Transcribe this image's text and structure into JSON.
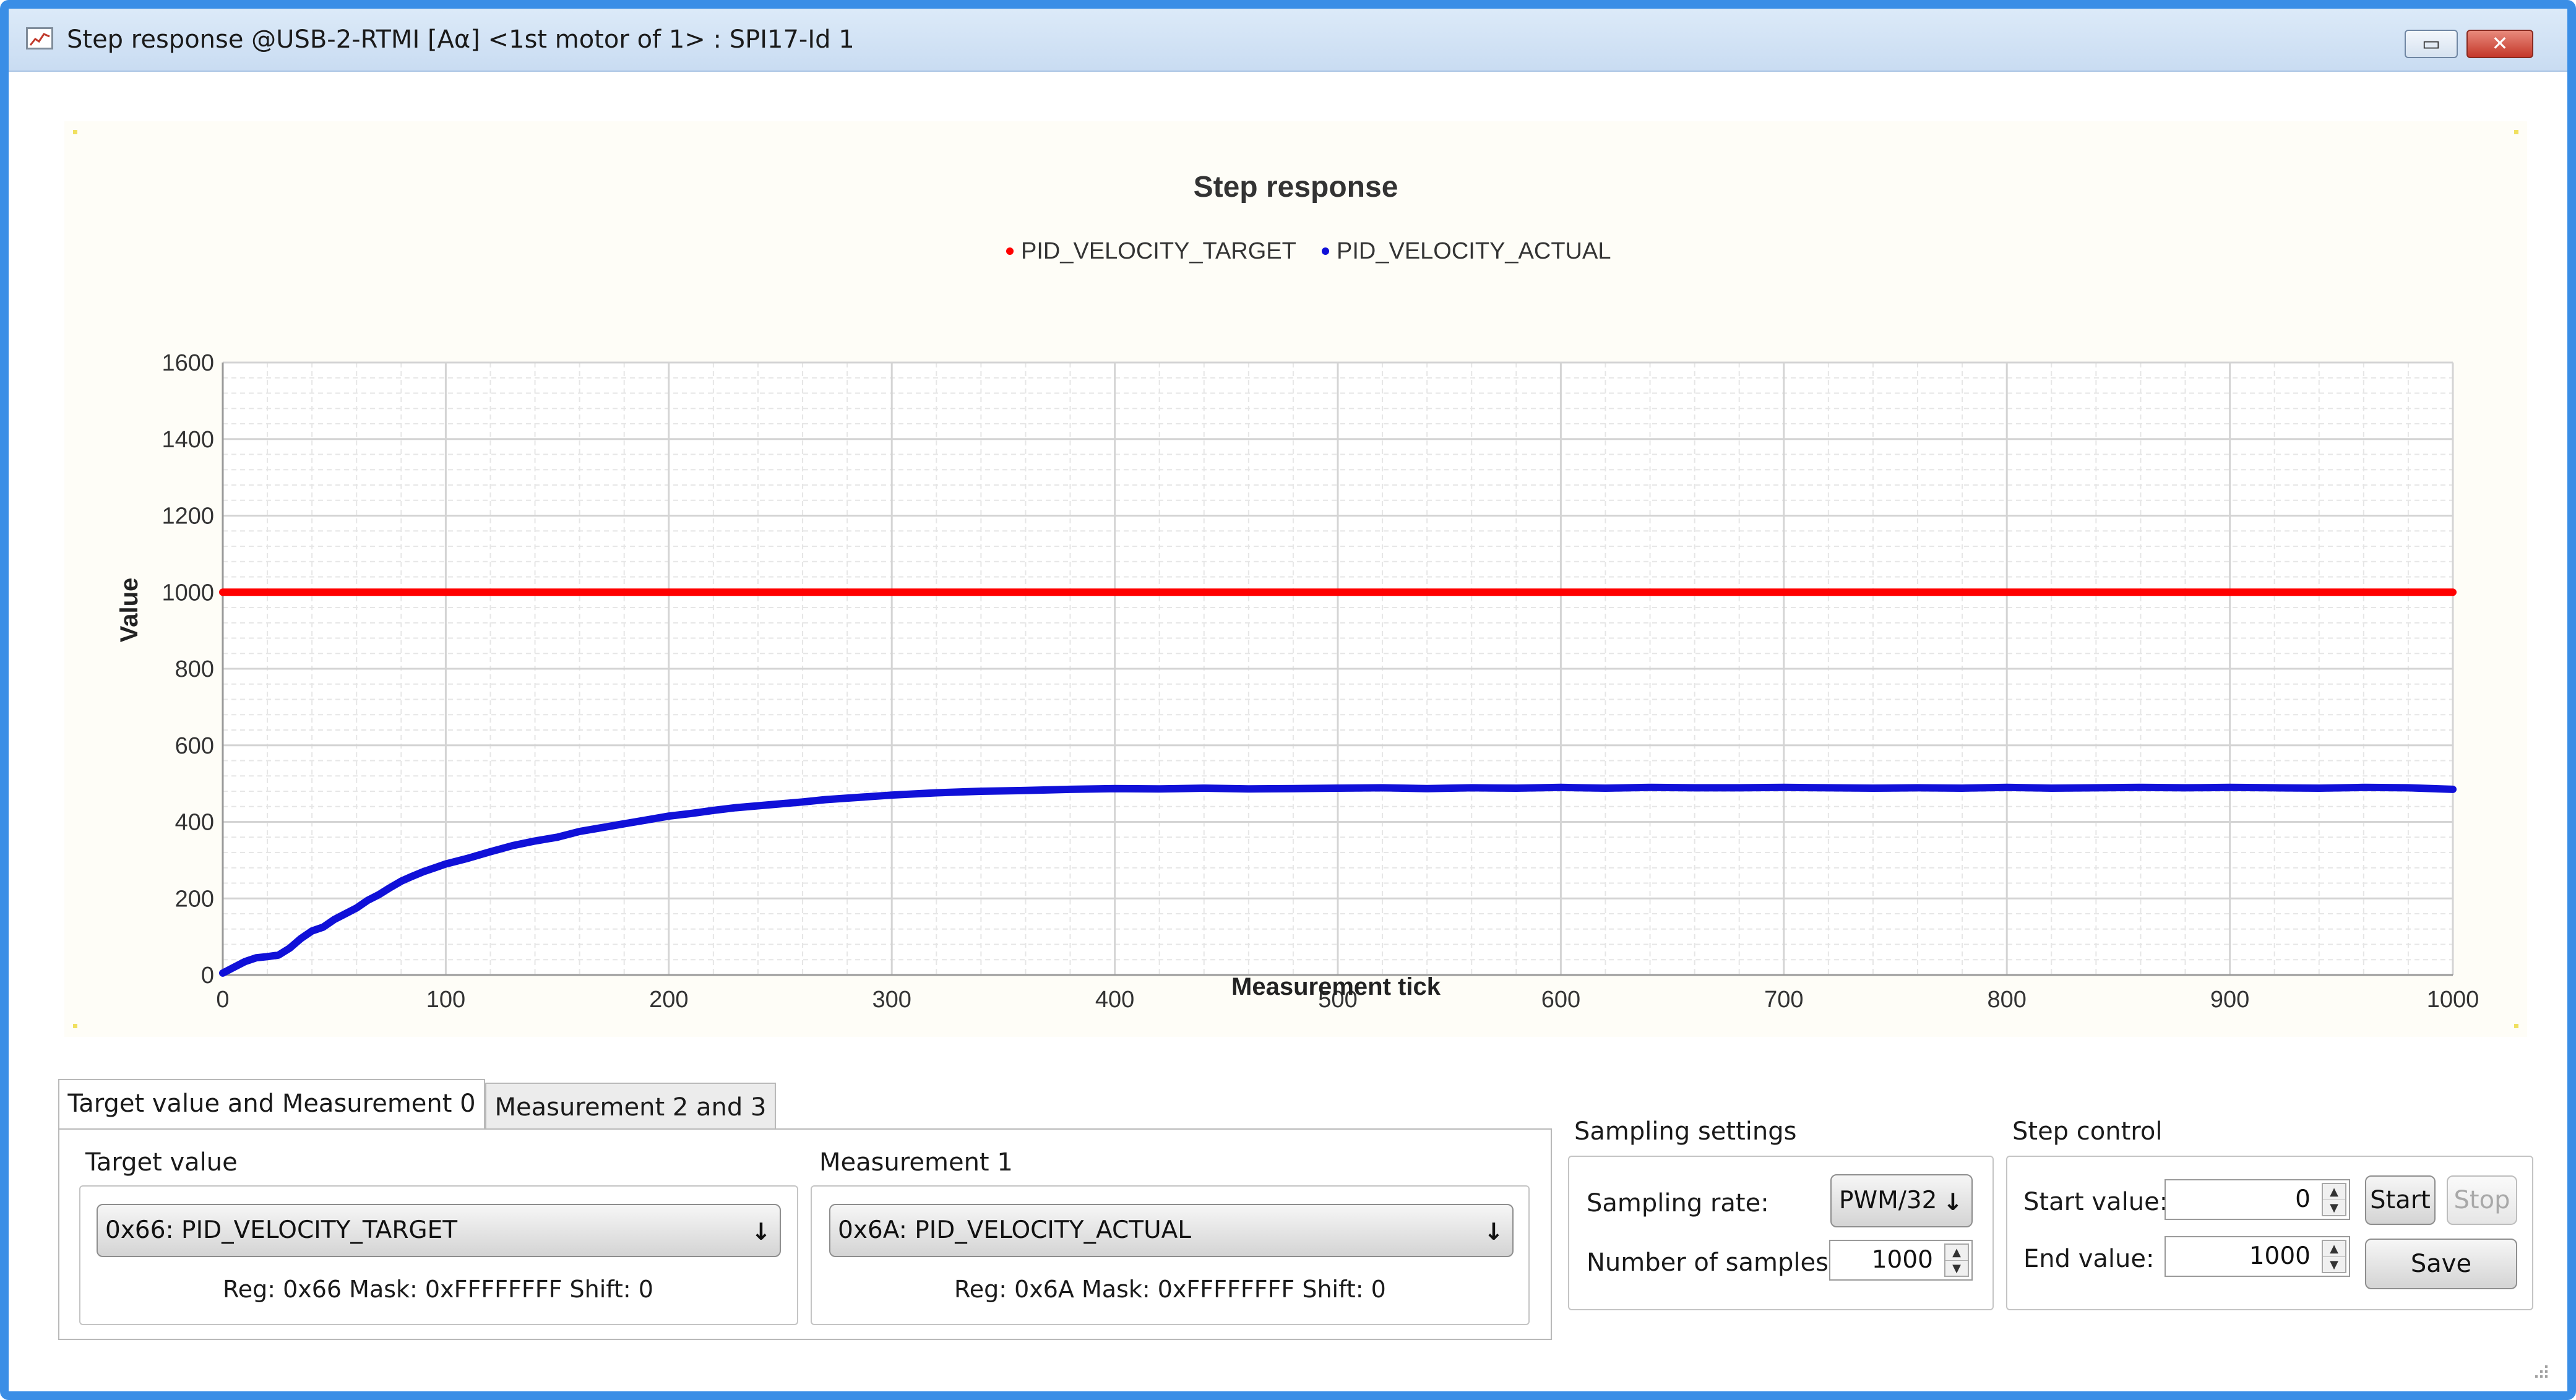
{
  "window": {
    "title": "Step response @USB-2-RTMI [Aα] <1st motor of 1> : SPI17-Id 1",
    "restore_symbol": "▭",
    "close_symbol": "✕",
    "app_icon": "chart-icon"
  },
  "chart_data": {
    "type": "line",
    "title": "Step response",
    "xlabel": "Measurement tick",
    "ylabel": "Value",
    "xlim": [
      0,
      1000
    ],
    "ylim": [
      0,
      1600
    ],
    "x_ticks": [
      "0",
      "100",
      "200",
      "300",
      "400",
      "500",
      "600",
      "700",
      "800",
      "900",
      "1000"
    ],
    "y_ticks": [
      "0",
      "200",
      "400",
      "600",
      "800",
      "1000",
      "1200",
      "1400",
      "1600"
    ],
    "grid": true,
    "legend_position": "top-center",
    "series": [
      {
        "name": "PID_VELOCITY_TARGET",
        "color": "#ff0000",
        "x": [
          0,
          1000
        ],
        "y": [
          1000,
          1000
        ]
      },
      {
        "name": "PID_VELOCITY_ACTUAL",
        "color": "#1010d8",
        "x": [
          0,
          5,
          10,
          15,
          20,
          25,
          30,
          35,
          40,
          45,
          50,
          55,
          60,
          65,
          70,
          75,
          80,
          85,
          90,
          95,
          100,
          110,
          120,
          130,
          140,
          150,
          160,
          170,
          180,
          190,
          200,
          210,
          220,
          230,
          240,
          250,
          260,
          270,
          280,
          290,
          300,
          320,
          340,
          360,
          380,
          400,
          420,
          440,
          460,
          480,
          500,
          520,
          540,
          560,
          580,
          600,
          620,
          640,
          660,
          680,
          700,
          720,
          740,
          760,
          780,
          800,
          820,
          840,
          860,
          880,
          900,
          920,
          940,
          960,
          980,
          1000
        ],
        "y": [
          5,
          20,
          35,
          45,
          48,
          52,
          70,
          95,
          115,
          125,
          145,
          160,
          175,
          195,
          210,
          228,
          245,
          258,
          270,
          280,
          290,
          305,
          322,
          338,
          350,
          360,
          375,
          385,
          395,
          405,
          415,
          422,
          430,
          437,
          442,
          447,
          452,
          458,
          462,
          466,
          470,
          476,
          480,
          482,
          485,
          487,
          486,
          488,
          486,
          487,
          488,
          489,
          487,
          489,
          488,
          490,
          488,
          490,
          489,
          489,
          490,
          489,
          488,
          489,
          488,
          490,
          488,
          489,
          490,
          489,
          490,
          489,
          488,
          490,
          489,
          485
        ]
      }
    ]
  },
  "tabs": [
    {
      "label": "Target value and Measurement 0",
      "active": true
    },
    {
      "label": "Measurement 2 and 3",
      "active": false
    }
  ],
  "target_group": {
    "label": "Target value",
    "selected": "0x66: PID_VELOCITY_TARGET",
    "reg_info": "Reg: 0x66   Mask: 0xFFFFFFFF   Shift: 0"
  },
  "measurement_group": {
    "label": "Measurement 1",
    "selected": "0x6A: PID_VELOCITY_ACTUAL",
    "reg_info": "Reg: 0x6A   Mask: 0xFFFFFFFF   Shift: 0"
  },
  "sampling": {
    "group_label": "Sampling settings",
    "rate_label": "Sampling rate:",
    "rate_value": "PWM/32",
    "samples_label": "Number of samples:",
    "samples_value": "1000"
  },
  "step_control": {
    "group_label": "Step control",
    "start_label": "Start value:",
    "start_value": "0",
    "end_label": "End value:",
    "end_value": "1000",
    "start_button": "Start",
    "stop_button": "Stop",
    "save_button": "Save"
  },
  "combo_arrow": "↓",
  "spin_up": "▲",
  "spin_down": "▼"
}
